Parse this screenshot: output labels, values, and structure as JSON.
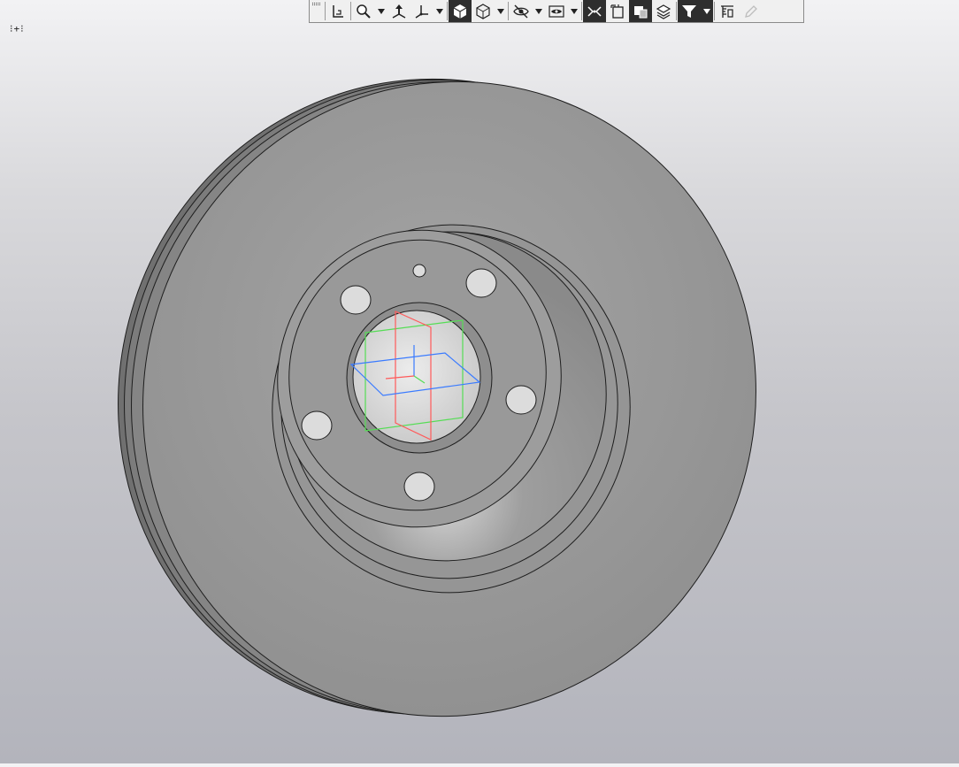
{
  "viewport": {
    "corner_indicator": "⁝+⁝",
    "model": "brake-disc",
    "background_top": "#f2f2f4",
    "background_bottom": "#b3b4bc"
  },
  "toolbar": {
    "buttons": [
      {
        "name": "grip-handle",
        "icon": "grip-icon"
      },
      {
        "name": "sketch-button",
        "icon": "sketch-icon"
      },
      {
        "name": "zoom-button",
        "icon": "zoom-icon",
        "dropdown": true
      },
      {
        "name": "orientation-button",
        "icon": "orientation-icon"
      },
      {
        "name": "axes-button",
        "icon": "axes-icon",
        "dropdown": true
      },
      {
        "name": "shaded-view-button",
        "icon": "shaded-cube-icon",
        "active": true
      },
      {
        "name": "wireframe-view-button",
        "icon": "wireframe-cube-icon",
        "dropdown": true
      },
      {
        "name": "hide-button",
        "icon": "hide-eye-icon",
        "dropdown": true
      },
      {
        "name": "show-button",
        "icon": "show-eye-icon",
        "dropdown": true
      },
      {
        "name": "constraints-button",
        "icon": "constraints-icon",
        "active": true
      },
      {
        "name": "section-button",
        "icon": "section-icon"
      },
      {
        "name": "display-mode-button",
        "icon": "display-mode-icon",
        "active": true
      },
      {
        "name": "layers-button",
        "icon": "layers-icon"
      },
      {
        "name": "filter-button",
        "icon": "filter-icon",
        "active": true,
        "dropdown": true
      },
      {
        "name": "measure-button",
        "icon": "measure-icon"
      },
      {
        "name": "pencil-button",
        "icon": "pencil-icon",
        "disabled": true
      }
    ]
  },
  "colors": {
    "disc_face": "#9b9b9b",
    "disc_edge": "#6e6e6e",
    "hub_inner": "#d8d8d8",
    "axis_x": "#ff5a5a",
    "axis_y": "#55dd55",
    "axis_z": "#3a7bff"
  }
}
